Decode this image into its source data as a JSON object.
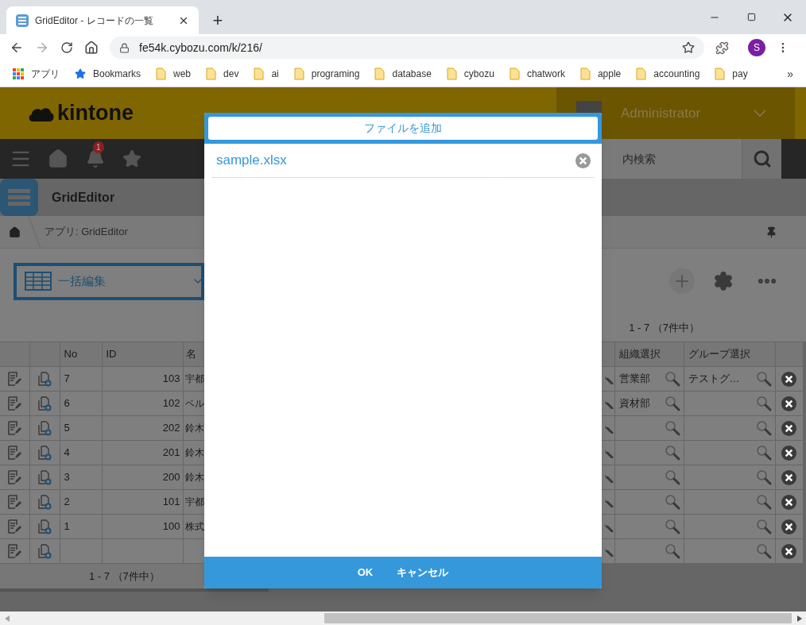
{
  "browser": {
    "tab_title": "GridEditor - レコードの一覧",
    "new_tab": "+",
    "url": "fe54k.cybozu.com/k/216/",
    "profile": "S",
    "more": "»",
    "bookmarks": [
      {
        "label": "アプリ",
        "kind": "apps"
      },
      {
        "label": "Bookmarks",
        "kind": "star"
      },
      {
        "label": "web",
        "kind": "folder"
      },
      {
        "label": "dev",
        "kind": "folder"
      },
      {
        "label": "ai",
        "kind": "folder"
      },
      {
        "label": "programing",
        "kind": "folder"
      },
      {
        "label": "database",
        "kind": "folder"
      },
      {
        "label": "cybozu",
        "kind": "folder"
      },
      {
        "label": "chatwork",
        "kind": "folder"
      },
      {
        "label": "apple",
        "kind": "folder"
      },
      {
        "label": "accounting",
        "kind": "folder"
      },
      {
        "label": "pay",
        "kind": "folder"
      }
    ]
  },
  "header": {
    "logo": "kintone",
    "user": "Administrator"
  },
  "nav": {
    "notification_count": "1",
    "search_placeholder": "内検索"
  },
  "app": {
    "title": "GridEditor"
  },
  "breadcrumb": {
    "label": "アプリ: GridEditor"
  },
  "view": {
    "name": "一括編集"
  },
  "record_count": "1 - 7 （7件中）",
  "table": {
    "columns": [
      "No",
      "ID",
      "名",
      "組織選択",
      "グループ選択"
    ],
    "rows": [
      {
        "kind": "record",
        "no": "7",
        "id": "103",
        "name": "宇都",
        "org": "営業部",
        "group": "テストグ…"
      },
      {
        "kind": "record",
        "no": "6",
        "id": "102",
        "name": "ベル",
        "org": "資材部"
      },
      {
        "kind": "record",
        "no": "5",
        "id": "202",
        "name": "鈴木"
      },
      {
        "kind": "record",
        "no": "4",
        "id": "201",
        "name": "鈴木"
      },
      {
        "kind": "record",
        "no": "3",
        "id": "200",
        "name": "鈴木"
      },
      {
        "kind": "record",
        "no": "2",
        "id": "101",
        "name": "宇都"
      },
      {
        "kind": "record",
        "no": "1",
        "id": "100",
        "name": "株式"
      },
      {
        "kind": "empty"
      }
    ]
  },
  "pager": "1 - 7 （7件中）",
  "dialog": {
    "add_button": "ファイルを追加",
    "files": [
      "sample.xlsx"
    ],
    "buttons": [
      "OK",
      "キャンセル"
    ]
  }
}
